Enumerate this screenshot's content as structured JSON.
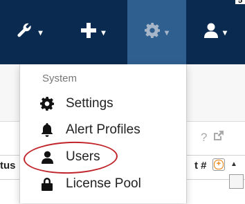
{
  "corner_glyph": "5",
  "navbar": {
    "buttons": [
      {
        "name": "tools",
        "icon": "wrench-icon",
        "caret": "▾",
        "active": false
      },
      {
        "name": "add",
        "icon": "plus-icon",
        "caret": "▾",
        "active": false
      },
      {
        "name": "settings",
        "icon": "gear-icon",
        "caret": "▾",
        "active": true
      },
      {
        "name": "user",
        "icon": "user-icon",
        "caret": "▾",
        "active": false
      }
    ],
    "bg_color": "#0a2a50",
    "active_color": "#2f5f8f"
  },
  "dropdown": {
    "header": "System",
    "items": [
      {
        "label": "Settings",
        "icon": "gear-icon"
      },
      {
        "label": "Alert Profiles",
        "icon": "bell-icon"
      },
      {
        "label": "Users",
        "icon": "user-icon",
        "highlighted": true
      },
      {
        "label": "License Pool",
        "icon": "lock-icon"
      }
    ]
  },
  "background": {
    "tools": [
      "?",
      "↗"
    ],
    "columns": {
      "status_partial": "tus",
      "count_partial": "t #"
    },
    "add_column": "+",
    "scroll_up": "▲"
  },
  "highlight_color": "#c0242a"
}
